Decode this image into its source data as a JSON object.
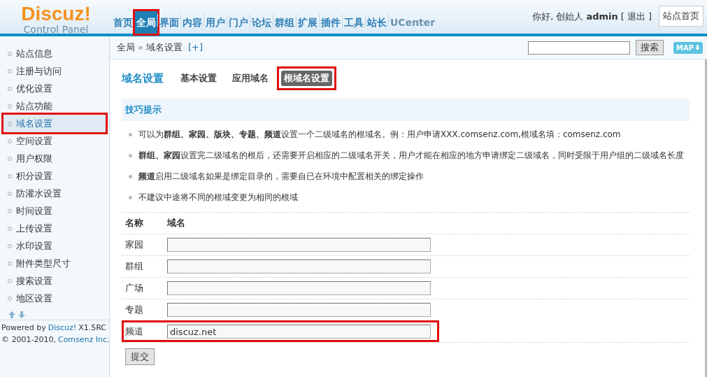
{
  "logo": {
    "title": "Discuz!",
    "subtitle": "Control Panel"
  },
  "nav": [
    {
      "label": "首页",
      "selected": false,
      "highlighted": false
    },
    {
      "label": "全局",
      "selected": true,
      "highlighted": true
    },
    {
      "label": "界面",
      "selected": false,
      "highlighted": false
    },
    {
      "label": "内容",
      "selected": false,
      "highlighted": false
    },
    {
      "label": "用户",
      "selected": false,
      "highlighted": false
    },
    {
      "label": "门户",
      "selected": false,
      "highlighted": false
    },
    {
      "label": "论坛",
      "selected": false,
      "highlighted": false
    },
    {
      "label": "群组",
      "selected": false,
      "highlighted": false
    },
    {
      "label": "扩展",
      "selected": false,
      "highlighted": false
    },
    {
      "label": "插件",
      "selected": false,
      "highlighted": false
    },
    {
      "label": "工具",
      "selected": false,
      "highlighted": false
    },
    {
      "label": "站长",
      "selected": false,
      "highlighted": false
    },
    {
      "label": "UCenter",
      "selected": false,
      "highlighted": false
    }
  ],
  "user": {
    "greeting": "你好, 创始人",
    "name": "admin",
    "logout_open": "[",
    "logout": "退出",
    "logout_close": "]",
    "home_button": "站点首页"
  },
  "breadcrumb": {
    "root": "全局",
    "separator": "»",
    "current": "域名设置",
    "add": "[+]"
  },
  "search": {
    "button": "搜索",
    "map": "MAP"
  },
  "sidebar": {
    "items": [
      {
        "label": "站点信息",
        "selected": false,
        "highlighted": false
      },
      {
        "label": "注册与访问",
        "selected": false,
        "highlighted": false
      },
      {
        "label": "优化设置",
        "selected": false,
        "highlighted": false
      },
      {
        "label": "站点功能",
        "selected": false,
        "highlighted": false
      },
      {
        "label": "域名设置",
        "selected": true,
        "highlighted": true
      },
      {
        "label": "空间设置",
        "selected": false,
        "highlighted": false
      },
      {
        "label": "用户权限",
        "selected": false,
        "highlighted": false
      },
      {
        "label": "积分设置",
        "selected": false,
        "highlighted": false
      },
      {
        "label": "防灌水设置",
        "selected": false,
        "highlighted": false
      },
      {
        "label": "时间设置",
        "selected": false,
        "highlighted": false
      },
      {
        "label": "上传设置",
        "selected": false,
        "highlighted": false
      },
      {
        "label": "水印设置",
        "selected": false,
        "highlighted": false
      },
      {
        "label": "附件类型尺寸",
        "selected": false,
        "highlighted": false
      },
      {
        "label": "搜索设置",
        "selected": false,
        "highlighted": false
      },
      {
        "label": "地区设置",
        "selected": false,
        "highlighted": false
      }
    ],
    "footer": {
      "powered": "Powered by",
      "brand": "Discuz!",
      "version": "X1.5RC",
      "copyright": "© 2001-2010,",
      "company": "Comsenz Inc."
    }
  },
  "page": {
    "title": "域名设置",
    "tabs": [
      {
        "label": "基本设置",
        "selected": false,
        "highlighted": false
      },
      {
        "label": "应用域名",
        "selected": false,
        "highlighted": false
      },
      {
        "label": "根域名设置",
        "selected": true,
        "highlighted": true
      }
    ]
  },
  "tips": {
    "title": "技巧提示",
    "items": [
      "可以为**群组、家园、版块、专题、频道**设置一个二级域名的根域名。例：用户申请XXX.comsenz.com,根域名填：comsenz.com",
      "**群组、家园**设置完二级域名的根后，还需要开启相应的二级域名开关，用户才能在相应的地方申请绑定二级域名，同时受限于用户组的二级域名长度",
      "**频道**启用二级域名如果是绑定目录的，需要自已在环境中配置相关的绑定操作",
      "不建议中途将不同的根域变更为相同的根域"
    ]
  },
  "table": {
    "columns": [
      "名称",
      "域名"
    ],
    "rows": [
      {
        "name": "家园",
        "value": "",
        "highlighted": false
      },
      {
        "name": "群组",
        "value": "",
        "highlighted": false
      },
      {
        "name": "广场",
        "value": "",
        "highlighted": false
      },
      {
        "name": "专题",
        "value": "",
        "highlighted": false
      },
      {
        "name": "频道",
        "value": "discuz.net",
        "highlighted": true
      }
    ]
  },
  "submit": "提交"
}
